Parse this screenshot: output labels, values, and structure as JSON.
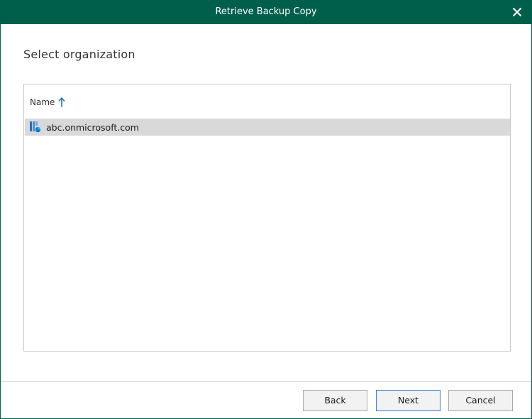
{
  "window": {
    "title": "Retrieve Backup Copy",
    "close_icon": "close-icon",
    "accent_color": "#005f4b"
  },
  "page": {
    "heading": "Select organization"
  },
  "list": {
    "column_header": "Name",
    "sort_icon": "arrow-up-icon",
    "sort_direction": "ascending",
    "rows": [
      {
        "name": "abc.onmicrosoft.com",
        "icon": "organization-icon",
        "selected": true
      }
    ]
  },
  "footer": {
    "back_label": "Back",
    "next_label": "Next",
    "cancel_label": "Cancel"
  }
}
